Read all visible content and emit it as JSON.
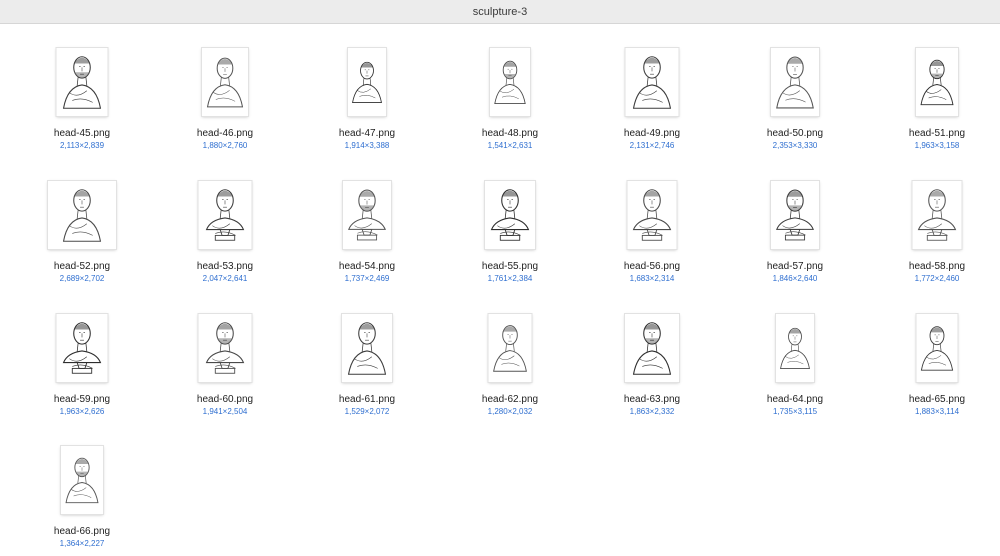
{
  "window": {
    "title": "sculpture-3"
  },
  "files": [
    {
      "name": "head-45.png",
      "dimensions": "2,113×2,839",
      "icon": "bust-sculpture-icon"
    },
    {
      "name": "head-46.png",
      "dimensions": "1,880×2,760",
      "icon": "bust-sculpture-icon"
    },
    {
      "name": "head-47.png",
      "dimensions": "1,914×3,388",
      "icon": "bust-sculpture-icon"
    },
    {
      "name": "head-48.png",
      "dimensions": "1,541×2,631",
      "icon": "bust-sculpture-icon"
    },
    {
      "name": "head-49.png",
      "dimensions": "2,131×2,746",
      "icon": "bust-sculpture-icon"
    },
    {
      "name": "head-50.png",
      "dimensions": "2,353×3,330",
      "icon": "bust-sculpture-icon"
    },
    {
      "name": "head-51.png",
      "dimensions": "1,963×3,158",
      "icon": "bust-sculpture-icon"
    },
    {
      "name": "head-52.png",
      "dimensions": "2,689×2,702",
      "icon": "bust-sculpture-icon"
    },
    {
      "name": "head-53.png",
      "dimensions": "2,047×2,641",
      "icon": "bust-sculpture-icon"
    },
    {
      "name": "head-54.png",
      "dimensions": "1,737×2,469",
      "icon": "bust-sculpture-icon"
    },
    {
      "name": "head-55.png",
      "dimensions": "1,761×2,384",
      "icon": "bust-sculpture-icon"
    },
    {
      "name": "head-56.png",
      "dimensions": "1,683×2,314",
      "icon": "bust-sculpture-icon"
    },
    {
      "name": "head-57.png",
      "dimensions": "1,846×2,640",
      "icon": "bust-sculpture-icon"
    },
    {
      "name": "head-58.png",
      "dimensions": "1,772×2,460",
      "icon": "bust-sculpture-icon"
    },
    {
      "name": "head-59.png",
      "dimensions": "1,963×2,626",
      "icon": "bust-sculpture-icon"
    },
    {
      "name": "head-60.png",
      "dimensions": "1,941×2,504",
      "icon": "bust-sculpture-icon"
    },
    {
      "name": "head-61.png",
      "dimensions": "1,529×2,072",
      "icon": "bust-sculpture-icon"
    },
    {
      "name": "head-62.png",
      "dimensions": "1,280×2,032",
      "icon": "bust-sculpture-icon"
    },
    {
      "name": "head-63.png",
      "dimensions": "1,863×2,332",
      "icon": "bust-sculpture-icon"
    },
    {
      "name": "head-64.png",
      "dimensions": "1,735×3,115",
      "icon": "bust-sculpture-icon"
    },
    {
      "name": "head-65.png",
      "dimensions": "1,883×3,114",
      "icon": "bust-sculpture-icon"
    },
    {
      "name": "head-66.png",
      "dimensions": "1,364×2,227",
      "icon": "bust-sculpture-icon"
    }
  ]
}
